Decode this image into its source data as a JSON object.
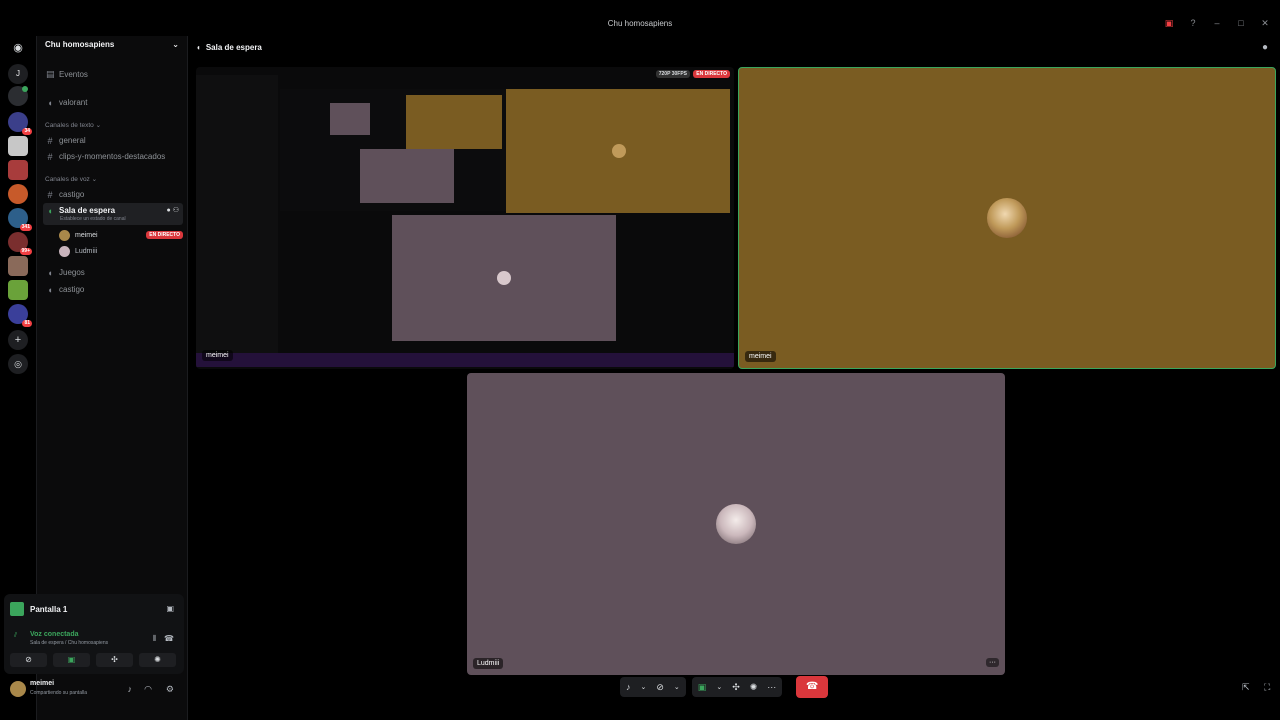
{
  "window": {
    "title": "Chu homosapiens"
  },
  "sidebar": {
    "server_name": "Chu homosapiens",
    "events_label": "Eventos",
    "channels_top": [
      {
        "label": "valorant"
      }
    ],
    "text_category": "Canales de texto",
    "text_channels": [
      {
        "label": "general"
      },
      {
        "label": "clips-y-momentos-destacados"
      }
    ],
    "voice_category": "Canales de voz",
    "voice_channels": [
      {
        "label": "castigo"
      },
      {
        "label": "Sala de espera",
        "status": "Establece un estado de canal"
      },
      {
        "label": "Juegos"
      },
      {
        "label": "castigo"
      }
    ],
    "voice_users": [
      {
        "name": "meimei",
        "badge": "EN DIRECTO"
      },
      {
        "name": "Ludmiii"
      }
    ]
  },
  "servers": {
    "badges": [
      "34",
      "341",
      "99+",
      "81"
    ]
  },
  "share_panel": {
    "title": "Pantalla 1",
    "voice_status": "Voz conectada",
    "voice_location": "Sala de espera / Chu homosapiens"
  },
  "user_panel": {
    "name": "meimei",
    "status": "Compartiendo su pantalla"
  },
  "main": {
    "channel_name": "Sala de espera",
    "stream_tile": {
      "label": "meimei",
      "quality": "720P 30FPS",
      "live": "EN DIRECTO"
    },
    "camera_tile_1": {
      "label": "meimei",
      "bg_color": "#7a5c22"
    },
    "camera_tile_2": {
      "label": "Ludmiii",
      "bg_color": "#5f505a"
    }
  },
  "colors": {
    "accent_green": "#3ba55c",
    "danger_red": "#da373c",
    "tile_brown": "#7a5c22",
    "tile_mauve": "#5f505a"
  }
}
